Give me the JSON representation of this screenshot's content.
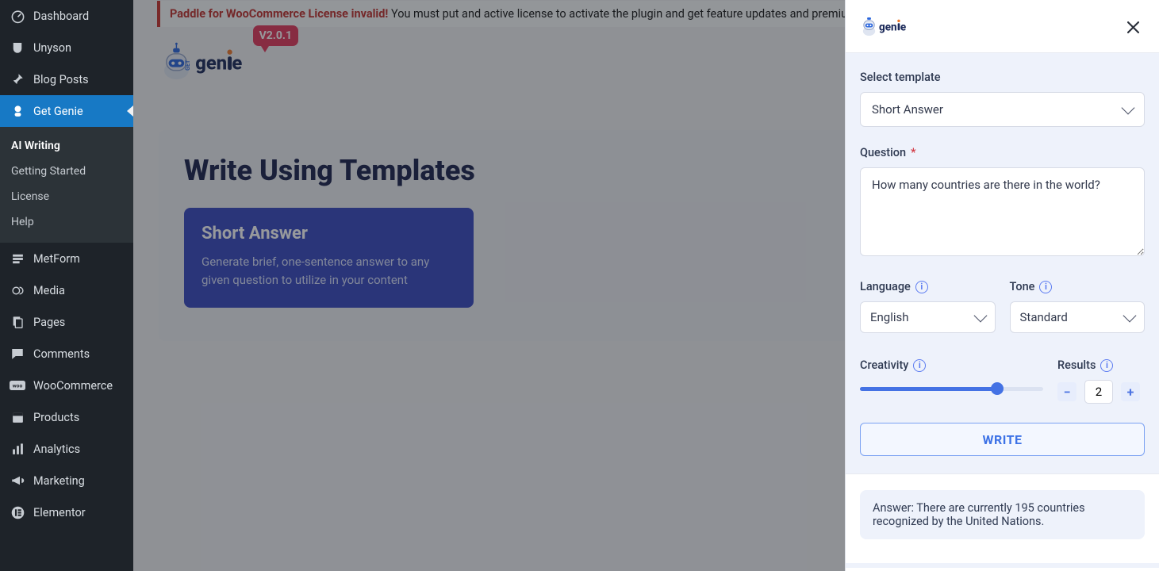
{
  "sidebar": {
    "items": [
      {
        "label": "Dashboard",
        "icon": "gauge"
      },
      {
        "label": "Unyson",
        "icon": "u"
      },
      {
        "label": "Blog Posts",
        "icon": "pin"
      },
      {
        "label": "Get Genie",
        "icon": "genie",
        "active": true
      },
      {
        "label": "MetForm",
        "icon": "form"
      },
      {
        "label": "Media",
        "icon": "media"
      },
      {
        "label": "Pages",
        "icon": "pages"
      },
      {
        "label": "Comments",
        "icon": "comment"
      },
      {
        "label": "WooCommerce",
        "icon": "woo"
      },
      {
        "label": "Products",
        "icon": "products"
      },
      {
        "label": "Analytics",
        "icon": "analytics"
      },
      {
        "label": "Marketing",
        "icon": "megaphone"
      },
      {
        "label": "Elementor",
        "icon": "elementor"
      }
    ],
    "submenu": [
      "AI Writing",
      "Getting Started",
      "License",
      "Help"
    ]
  },
  "notice": {
    "bold": "Paddle for WooCommerce License invalid!",
    "text": " You must put and active license to activate the plugin and get feature updates and premium sup"
  },
  "brand": {
    "version": "V2.0.1",
    "name": "genie"
  },
  "content": {
    "title": "Write Using Templates",
    "template_card": {
      "title": "Short Answer",
      "desc": "Generate brief, one-sentence answer to any given question to utilize in your content"
    }
  },
  "panel": {
    "select_label": "Select template",
    "select_value": "Short Answer",
    "question_label": "Question",
    "question_value": "How many countries are there in the world?",
    "language_label": "Language",
    "language_value": "English",
    "tone_label": "Tone",
    "tone_value": "Standard",
    "creativity_label": "Creativity",
    "creativity_pct": 75,
    "results_label": "Results",
    "results_value": "2",
    "write_label": "WRITE",
    "answer": "Answer: There are currently 195 countries recognized by the United Nations."
  }
}
